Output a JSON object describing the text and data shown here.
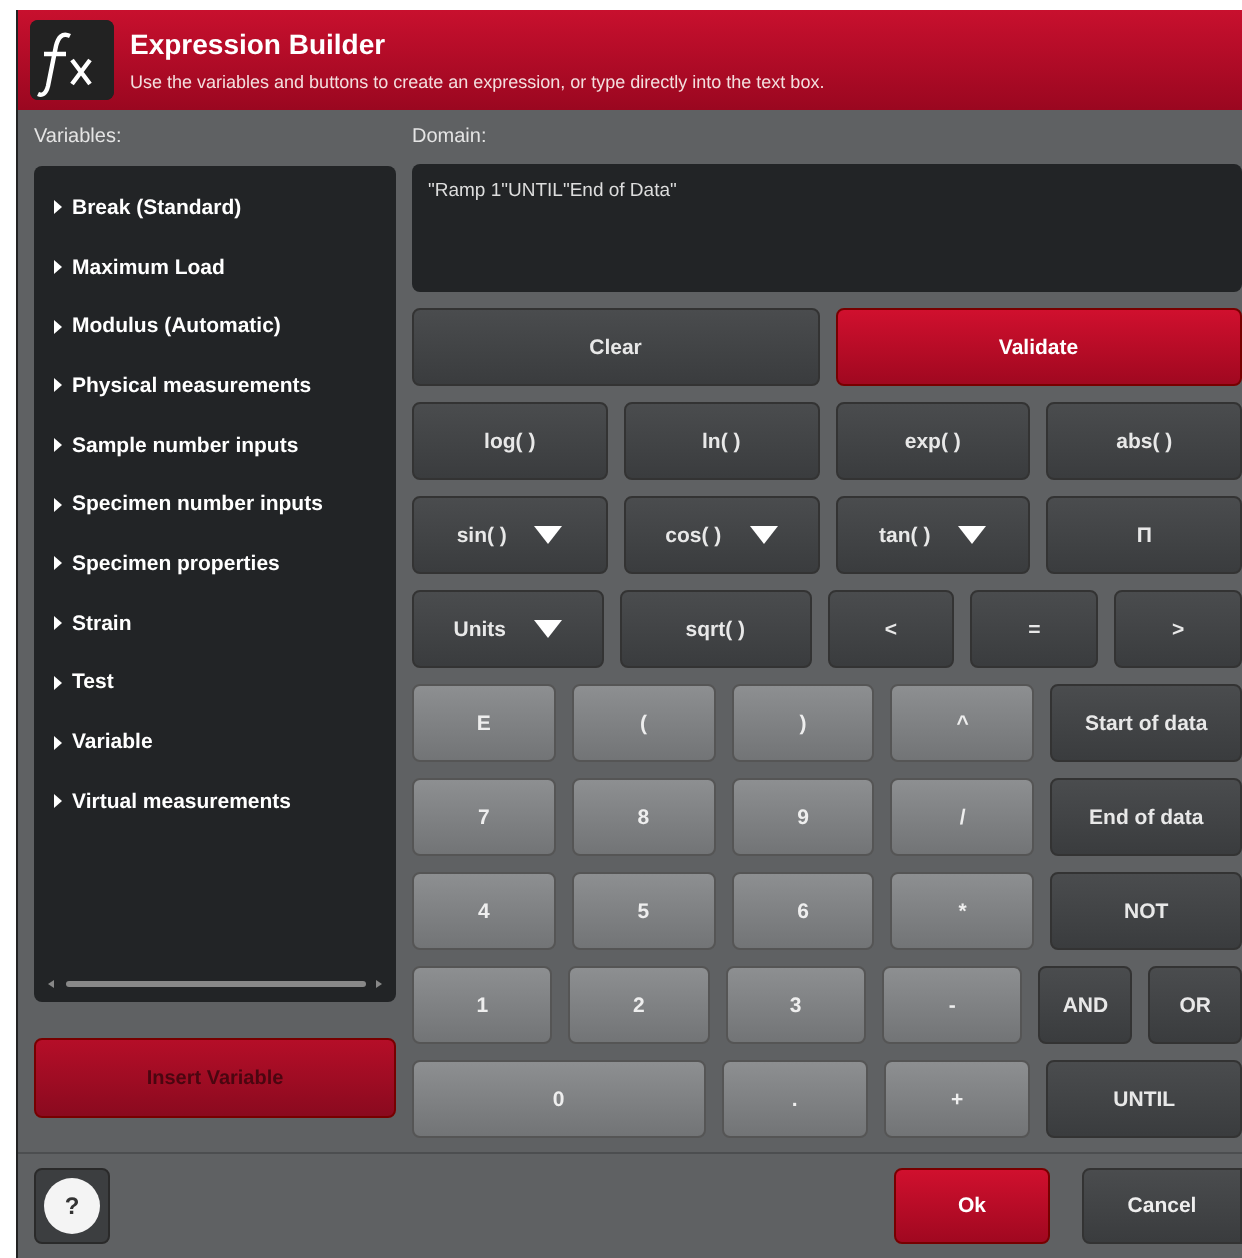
{
  "header": {
    "title": "Expression Builder",
    "subtitle": "Use the variables and buttons to create an expression, or type directly into the text box."
  },
  "variables": {
    "label": "Variables:",
    "items": [
      {
        "label": "Break (Standard)"
      },
      {
        "label": "Maximum Load"
      },
      {
        "label": "Modulus (Automatic)"
      },
      {
        "label": "Physical measurements"
      },
      {
        "label": "Sample number inputs"
      },
      {
        "label": "Specimen number inputs"
      },
      {
        "label": "Specimen properties"
      },
      {
        "label": "Strain"
      },
      {
        "label": "Test"
      },
      {
        "label": "Variable"
      },
      {
        "label": "Virtual measurements"
      }
    ],
    "insert_button": {
      "label": "Insert Variable",
      "disabled": true
    }
  },
  "domain": {
    "label": "Domain:",
    "value": "\"Ramp 1\"UNTIL\"End of Data\""
  },
  "keypad": [
    [
      {
        "label": "Clear",
        "kind": "dark",
        "dropdown": false
      },
      {
        "label": "Validate",
        "kind": "accent",
        "dropdown": false
      }
    ],
    [
      {
        "label": "log( )",
        "kind": "dark",
        "dropdown": false
      },
      {
        "label": "ln( )",
        "kind": "dark",
        "dropdown": false
      },
      {
        "label": "exp( )",
        "kind": "dark",
        "dropdown": false
      },
      {
        "label": "abs( )",
        "kind": "dark",
        "dropdown": false
      }
    ],
    [
      {
        "label": "sin( )",
        "kind": "dark",
        "dropdown": true
      },
      {
        "label": "cos( )",
        "kind": "dark",
        "dropdown": true
      },
      {
        "label": "tan( )",
        "kind": "dark",
        "dropdown": true
      },
      {
        "label": "Π",
        "kind": "dark",
        "dropdown": false
      }
    ],
    [
      {
        "label": "Units",
        "kind": "dark",
        "dropdown": true
      },
      {
        "label": "sqrt( )",
        "kind": "dark",
        "dropdown": false
      },
      {
        "label": "<",
        "kind": "dark",
        "dropdown": false
      },
      {
        "label": "=",
        "kind": "dark",
        "dropdown": false
      },
      {
        "label": ">",
        "kind": "dark",
        "dropdown": false
      }
    ],
    [
      {
        "label": "E",
        "kind": "light",
        "dropdown": false
      },
      {
        "label": "(",
        "kind": "light",
        "dropdown": false
      },
      {
        "label": ")",
        "kind": "light",
        "dropdown": false
      },
      {
        "label": "^",
        "kind": "light",
        "dropdown": false
      },
      {
        "label": "Start of data",
        "kind": "dark",
        "dropdown": false
      }
    ],
    [
      {
        "label": "7",
        "kind": "light",
        "dropdown": false
      },
      {
        "label": "8",
        "kind": "light",
        "dropdown": false
      },
      {
        "label": "9",
        "kind": "light",
        "dropdown": false
      },
      {
        "label": "/",
        "kind": "light",
        "dropdown": false
      },
      {
        "label": "End of data",
        "kind": "dark",
        "dropdown": false
      }
    ],
    [
      {
        "label": "4",
        "kind": "light",
        "dropdown": false
      },
      {
        "label": "5",
        "kind": "light",
        "dropdown": false
      },
      {
        "label": "6",
        "kind": "light",
        "dropdown": false
      },
      {
        "label": "*",
        "kind": "light",
        "dropdown": false
      },
      {
        "label": "NOT",
        "kind": "dark",
        "dropdown": false
      }
    ],
    [
      {
        "label": "1",
        "kind": "light",
        "dropdown": false
      },
      {
        "label": "2",
        "kind": "light",
        "dropdown": false
      },
      {
        "label": "3",
        "kind": "light",
        "dropdown": false
      },
      {
        "label": "-",
        "kind": "light",
        "dropdown": false
      },
      {
        "label": "AND",
        "kind": "dark",
        "dropdown": false
      },
      {
        "label": "OR",
        "kind": "dark",
        "dropdown": false
      }
    ],
    [
      {
        "label": "0",
        "kind": "light",
        "dropdown": false
      },
      {
        "label": ".",
        "kind": "light",
        "dropdown": false
      },
      {
        "label": "+",
        "kind": "light",
        "dropdown": false
      },
      {
        "label": "UNTIL",
        "kind": "dark",
        "dropdown": false
      }
    ]
  ],
  "footer": {
    "help": "?",
    "ok": "Ok",
    "cancel": "Cancel"
  }
}
